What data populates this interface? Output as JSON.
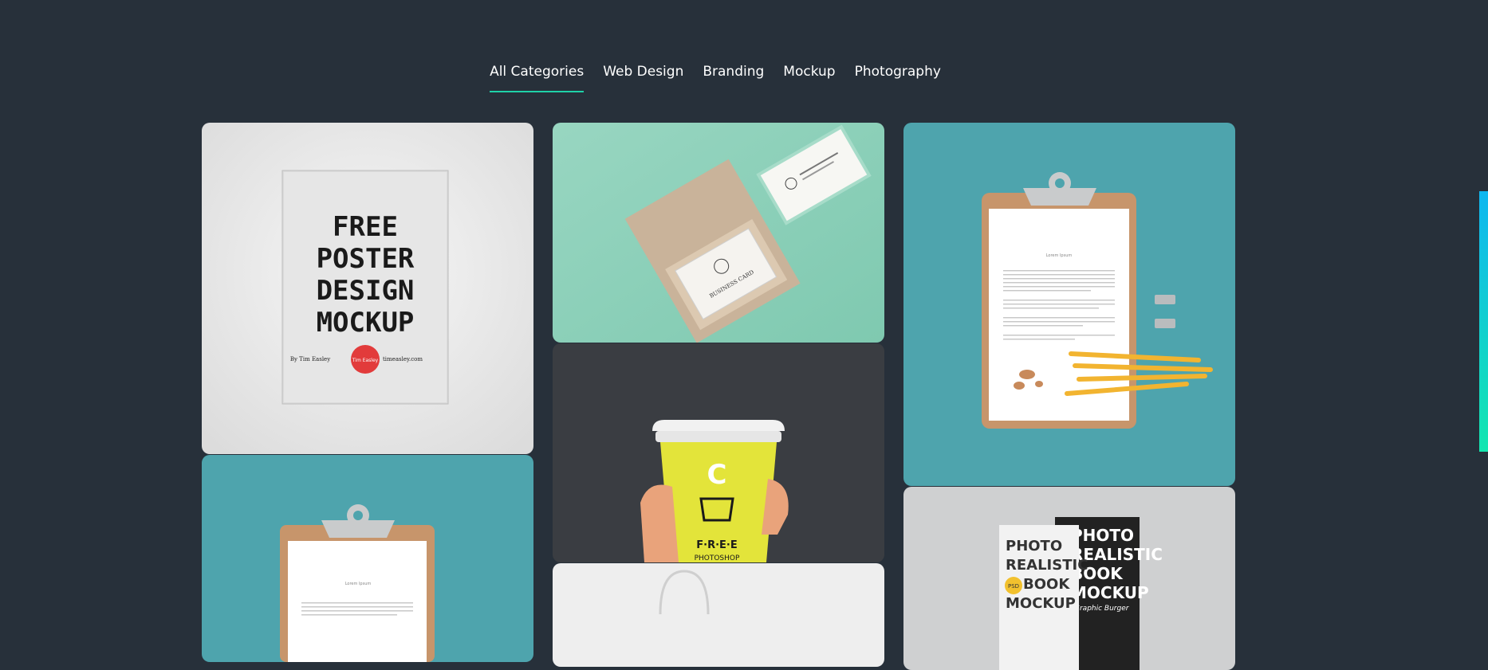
{
  "filters": [
    {
      "label": "All Categories",
      "active": true
    },
    {
      "label": "Web Design"
    },
    {
      "label": "Branding"
    },
    {
      "label": "Mockup"
    },
    {
      "label": "Photography"
    }
  ],
  "portfolio": {
    "poster": {
      "lines": [
        "FREE",
        "POSTER",
        "DESIGN",
        "MOCKUP"
      ],
      "by": "By Tim Easley",
      "badge": "Tim Easley",
      "site": "timeasley.com"
    },
    "business_card": {
      "label": "BUSINESS CARD"
    },
    "clipboard": {
      "heading": "Lorem Ipsum"
    },
    "cup": {
      "letter": "C",
      "word": "F·R·E·E",
      "sub": "PHOTOSHOP"
    },
    "book": {
      "lines": [
        "PHOTO",
        "REALISTIC",
        "BOOK",
        "MOCKUP"
      ],
      "badge": "PSD",
      "back_lines": [
        "PHOTO",
        "REALISTIC",
        "BOOK",
        "MOCKUP"
      ],
      "back_sub": "Graphic Burger"
    }
  },
  "colors": {
    "background": "#27303a",
    "accent": "#1fd1a8",
    "teal": "#4ea4ad",
    "mint": "#8fd3bc"
  }
}
